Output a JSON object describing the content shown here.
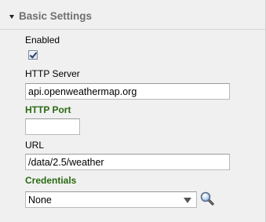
{
  "section": {
    "title": "Basic Settings"
  },
  "fields": {
    "enabled": {
      "label": "Enabled",
      "checked": true
    },
    "http_server": {
      "label": "HTTP Server",
      "value": "api.openweathermap.org"
    },
    "http_port": {
      "label": "HTTP Port",
      "value": ""
    },
    "url": {
      "label": "URL",
      "value": "/data/2.5/weather"
    },
    "credentials": {
      "label": "Credentials",
      "selected": "None"
    }
  },
  "colors": {
    "required_label": "#2a6a12",
    "section_title": "#707070",
    "background": "#f0f0f0"
  },
  "icons": {
    "collapse": "triangle-down-icon",
    "lookup": "magnifier-icon"
  }
}
